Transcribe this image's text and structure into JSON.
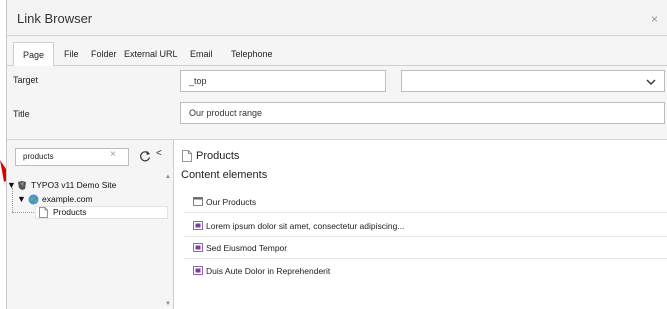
{
  "modal": {
    "title": "Link Browser",
    "close_symbol": "×"
  },
  "tabs": [
    {
      "label": "Page",
      "active": true
    },
    {
      "label": "File",
      "active": false
    },
    {
      "label": "Folder",
      "active": false
    },
    {
      "label": "External URL",
      "active": false
    },
    {
      "label": "Email",
      "active": false
    },
    {
      "label": "Telephone",
      "active": false
    }
  ],
  "form": {
    "target_label": "Target",
    "target_value": "_top",
    "target_select_value": "",
    "title_label": "Title",
    "title_value": "Our product range"
  },
  "tree": {
    "filter_value": "products",
    "clear_symbol": "×",
    "collapse_symbol": "<",
    "nodes": [
      {
        "label": "TYPO3 v11 Demo Site",
        "icon": "typo3-logo-icon"
      },
      {
        "label": "example.com",
        "icon": "globe-icon"
      },
      {
        "label": "Products",
        "icon": "page-icon",
        "selected": true
      }
    ]
  },
  "content": {
    "page_title": "Products",
    "section_title": "Content elements",
    "elements": [
      {
        "label": "Our Products",
        "icon": "header-icon"
      },
      {
        "label": "Lorem ipsum dolor sit amet, consectetur adipiscing...",
        "icon": "text-media-icon"
      },
      {
        "label": "Sed Eiusmod Tempor",
        "icon": "text-media-icon"
      },
      {
        "label": "Duis Aute Dolor in Reprehenderit",
        "icon": "text-media-icon"
      }
    ]
  },
  "colors": {
    "accent_red": "#e00000",
    "ce_icon_purple": "#7a3c9f"
  }
}
